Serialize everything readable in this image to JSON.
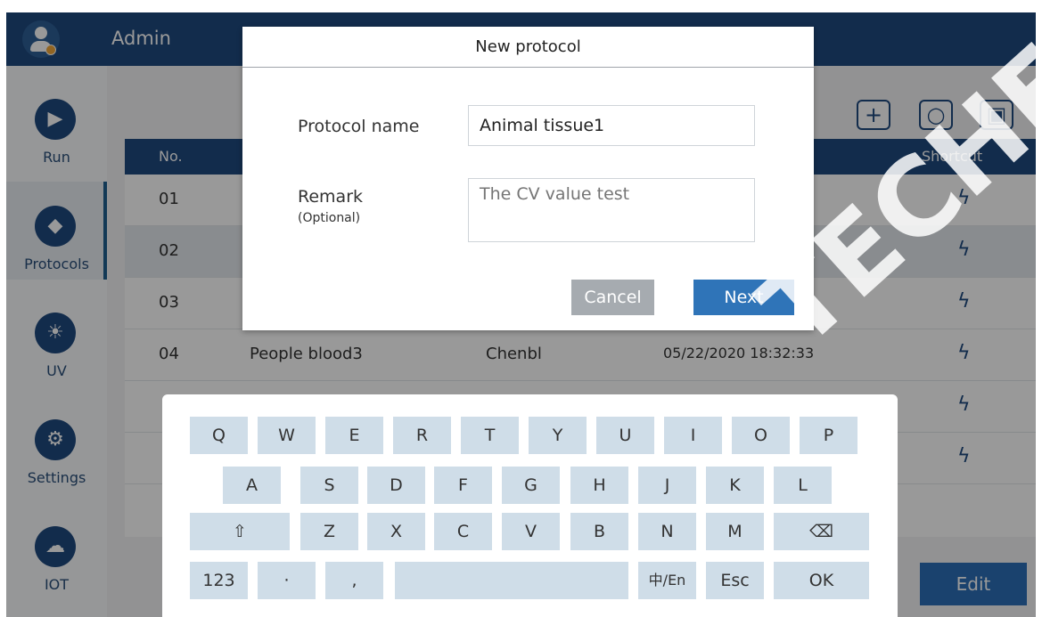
{
  "header": {
    "username": "Admin"
  },
  "sidebar": {
    "items": [
      {
        "label": "Run",
        "icon": "play-icon"
      },
      {
        "label": "Protocols",
        "icon": "grid-icon",
        "active": true
      },
      {
        "label": "UV",
        "icon": "bulb-icon"
      },
      {
        "label": "Settings",
        "icon": "gear-icon"
      },
      {
        "label": "IOT",
        "icon": "cloud-icon"
      }
    ]
  },
  "toolbar": {
    "add_icon": "plus-icon",
    "search_icon": "search-icon",
    "save_icon": "save-icon"
  },
  "table": {
    "columns": {
      "no": "No.",
      "shortcut": "Shortcut"
    },
    "rows": [
      {
        "no": "01",
        "name": "",
        "creator": "",
        "date": ""
      },
      {
        "no": "02",
        "name": "",
        "creator": "",
        "date": ""
      },
      {
        "no": "03",
        "name": "",
        "creator": "",
        "date": ""
      },
      {
        "no": "04",
        "name": "People blood3",
        "creator": "Chenbl",
        "date": "05/22/2020 18:32:33"
      }
    ]
  },
  "edit_label": "Edit",
  "dialog": {
    "title": "New protocol",
    "name_label": "Protocol name",
    "name_value": "Animal tissue1",
    "remark_label": "Remark",
    "remark_sub": "(Optional)",
    "remark_placeholder": "The CV value test",
    "cancel_label": "Cancel",
    "next_label": "Next"
  },
  "keyboard": {
    "row1": [
      "Q",
      "W",
      "E",
      "R",
      "T",
      "Y",
      "U",
      "I",
      "O",
      "P"
    ],
    "row2": [
      "A",
      "S",
      "D",
      "F",
      "G",
      "H",
      "J",
      "K",
      "L"
    ],
    "row3": [
      "⇧",
      "Z",
      "X",
      "C",
      "V",
      "B",
      "N",
      "M",
      "⌫"
    ],
    "row4": [
      "123",
      "·",
      ",",
      "",
      "中/En",
      "Esc",
      "OK"
    ]
  },
  "watermark": "TECHER SA",
  "colors": {
    "primary": "#1f4a7f",
    "accent": "#2f74b8",
    "key": "#cfdde8"
  }
}
